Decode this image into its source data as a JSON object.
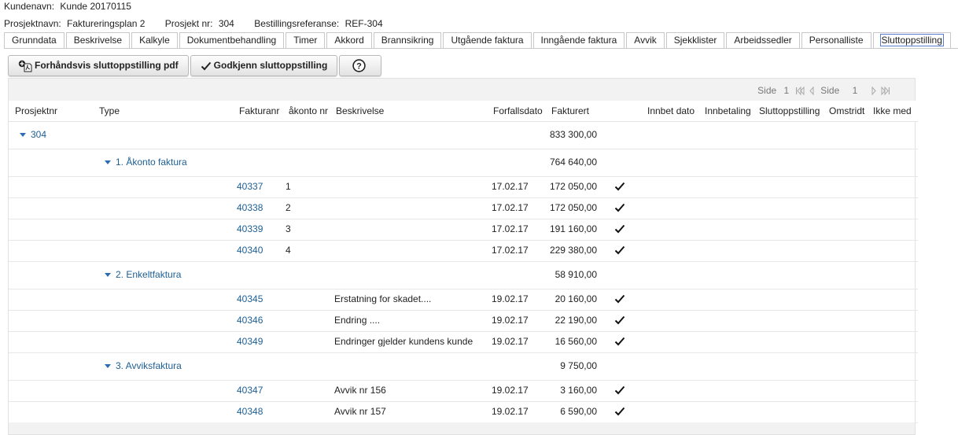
{
  "info": {
    "kundenavn_label": "Kundenavn:",
    "kundenavn_value": "Kunde 20170115",
    "prosjektnavn_label": "Prosjektnavn:",
    "prosjektnavn_value": "Faktureringsplan 2",
    "prosjektnr_label": "Prosjekt nr:",
    "prosjektnr_value": "304",
    "bestilling_label": "Bestillingsreferanse:",
    "bestilling_value": "REF-304"
  },
  "tabs": [
    "Grunndata",
    "Beskrivelse",
    "Kalkyle",
    "Dokumentbehandling",
    "Timer",
    "Akkord",
    "Brannsikring",
    "Utgående faktura",
    "Inngående faktura",
    "Avvik",
    "Sjekklister",
    "Arbeidssedler",
    "Personalliste",
    "Sluttoppstilling"
  ],
  "active_tab": "Sluttoppstilling",
  "toolbar": {
    "preview_label": "Forhåndsvis sluttoppstilling pdf",
    "approve_label": "Godkjenn sluttoppstilling",
    "help_icon": "help-icon"
  },
  "pager": {
    "side_label": "Side",
    "current": "1",
    "total_label": "Side",
    "total": "1"
  },
  "columns": {
    "prosjektnr": "Prosjektnr",
    "type": "Type",
    "fakturanr": "Fakturanr",
    "akonto": "åkonto nr",
    "beskrivelse": "Beskrivelse",
    "forfallsdato": "Forfallsdato",
    "fakturert": "Fakturert",
    "innbet_dato": "Innbet dato",
    "innbetaling": "Innbetaling",
    "sluttoppstilling": "Sluttoppstilling",
    "omstridt": "Omstridt",
    "ikke_med": "Ikke med"
  },
  "project": {
    "nr": "304",
    "total": "833 300,00"
  },
  "groups": [
    {
      "label": "1. Åkonto faktura",
      "total": "764 640,00",
      "rows": [
        {
          "fakturanr": "40337",
          "akonto": "1",
          "beskrivelse": "",
          "dato": "17.02.17",
          "belop": "172 050,00"
        },
        {
          "fakturanr": "40338",
          "akonto": "2",
          "beskrivelse": "",
          "dato": "17.02.17",
          "belop": "172 050,00"
        },
        {
          "fakturanr": "40339",
          "akonto": "3",
          "beskrivelse": "",
          "dato": "17.02.17",
          "belop": "191 160,00"
        },
        {
          "fakturanr": "40340",
          "akonto": "4",
          "beskrivelse": "",
          "dato": "17.02.17",
          "belop": "229 380,00"
        }
      ]
    },
    {
      "label": "2. Enkeltfaktura",
      "total": "58 910,00",
      "rows": [
        {
          "fakturanr": "40345",
          "akonto": "",
          "beskrivelse": "Erstatning for skadet....",
          "dato": "19.02.17",
          "belop": "20 160,00"
        },
        {
          "fakturanr": "40346",
          "akonto": "",
          "beskrivelse": "Endring ....",
          "dato": "19.02.17",
          "belop": "22 190,00"
        },
        {
          "fakturanr": "40349",
          "akonto": "",
          "beskrivelse": "Endringer gjelder kundens kunde",
          "dato": "19.02.17",
          "belop": "16 560,00"
        }
      ]
    },
    {
      "label": "3. Avviksfaktura",
      "total": "9 750,00",
      "rows": [
        {
          "fakturanr": "40347",
          "akonto": "",
          "beskrivelse": "Avvik nr 156",
          "dato": "19.02.17",
          "belop": "3 160,00"
        },
        {
          "fakturanr": "40348",
          "akonto": "",
          "beskrivelse": "Avvik nr 157",
          "dato": "19.02.17",
          "belop": "6 590,00"
        }
      ]
    }
  ]
}
